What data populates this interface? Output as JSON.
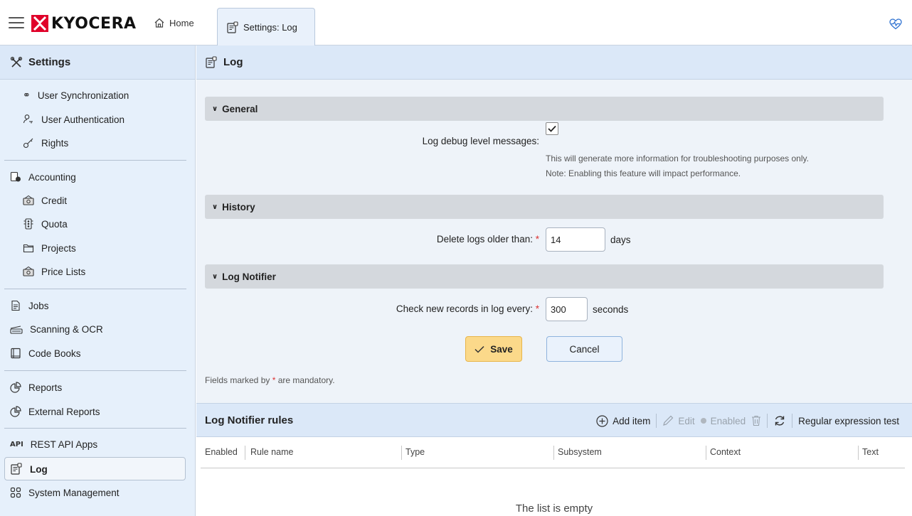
{
  "topbar": {
    "logo_text": "KYOCERA",
    "home_tab": "Home",
    "active_tab": "Settings: Log"
  },
  "sidebar": {
    "title": "Settings",
    "items": [
      {
        "label": "User Synchronization",
        "icon": "users-sync-icon"
      },
      {
        "label": "User Authentication",
        "icon": "user-key-icon"
      },
      {
        "label": "Rights",
        "icon": "key-icon"
      },
      {
        "label": "Accounting",
        "icon": "accounting-icon"
      },
      {
        "label": "Credit",
        "icon": "money-icon"
      },
      {
        "label": "Quota",
        "icon": "quota-icon"
      },
      {
        "label": "Projects",
        "icon": "folder-icon"
      },
      {
        "label": "Price Lists",
        "icon": "money-icon"
      },
      {
        "label": "Jobs",
        "icon": "document-icon"
      },
      {
        "label": "Scanning & OCR",
        "icon": "scanner-icon"
      },
      {
        "label": "Code Books",
        "icon": "book-icon"
      },
      {
        "label": "Reports",
        "icon": "pie-chart-icon"
      },
      {
        "label": "External Reports",
        "icon": "pie-chart-icon"
      },
      {
        "label": "REST API Apps",
        "icon": "api-icon"
      },
      {
        "label": "Log",
        "icon": "log-icon"
      },
      {
        "label": "System Management",
        "icon": "grid-icon"
      }
    ]
  },
  "main": {
    "title": "Log",
    "general": {
      "title": "General",
      "debug_label": "Log debug level messages:",
      "debug_checked": true,
      "hint1": "This will generate more information for troubleshooting purposes only.",
      "hint2": "Note: Enabling this feature will impact performance."
    },
    "history": {
      "title": "History",
      "delete_label": "Delete logs older than:",
      "delete_value": "14",
      "delete_unit": "days"
    },
    "notifier": {
      "title": "Log Notifier",
      "check_label": "Check new records in log every:",
      "check_value": "300",
      "check_unit": "seconds"
    },
    "save_label": "Save",
    "cancel_label": "Cancel",
    "mandatory_note_pre": "Fields marked by",
    "mandatory_note_post": "are mandatory.",
    "required_mark": "*"
  },
  "rules": {
    "title": "Log Notifier rules",
    "toolbar": {
      "add": "Add item",
      "edit": "Edit",
      "enabled": "Enabled",
      "regex": "Regular expression test"
    },
    "columns": [
      "Enabled",
      "Rule name",
      "Type",
      "Subsystem",
      "Context",
      "Text"
    ],
    "empty_text": "The list is empty"
  },
  "colors": {
    "accent_blue": "#dbe8f8",
    "save_yellow": "#fbd98a",
    "logo_red": "#e0002a",
    "required_red": "#dd3333"
  }
}
